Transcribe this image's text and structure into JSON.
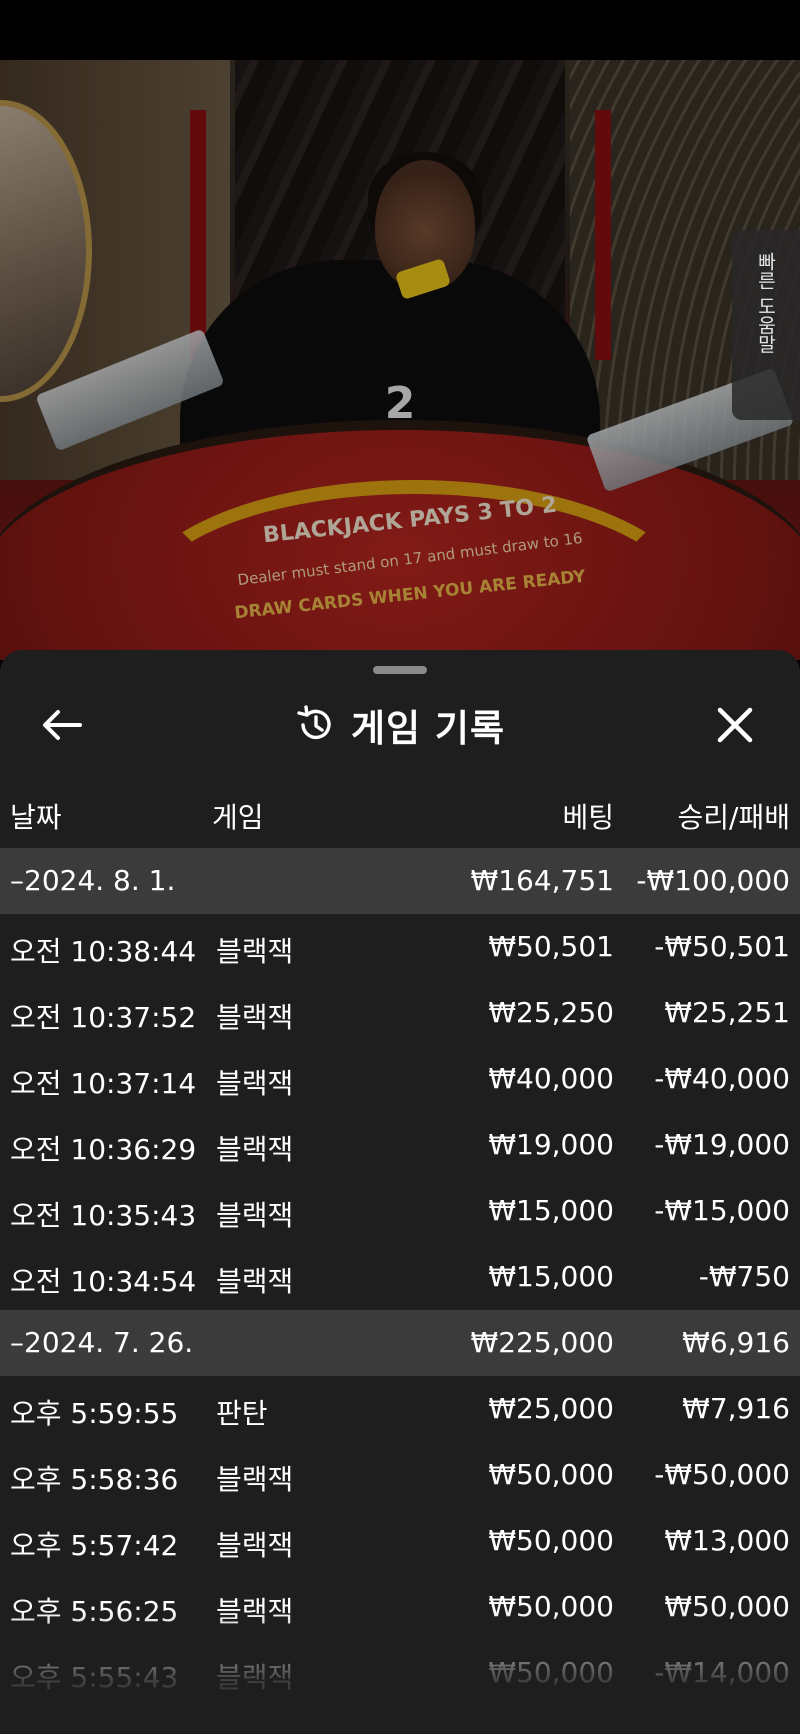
{
  "video": {
    "countdown": "2",
    "table_headline": "BLACKJACK PAYS 3 TO 2",
    "table_rule": "Dealer must stand on 17 and must draw to 16",
    "table_tagline": "DRAW CARDS WHEN YOU ARE READY",
    "help_tab_label": "빠른 도움말"
  },
  "sheet": {
    "title": "게임 기록",
    "columns": {
      "date": "날짜",
      "game": "게임",
      "bet": "베팅",
      "result": "승리/패배"
    },
    "rows": [
      {
        "type": "group",
        "time": "–2024. 8. 1.",
        "game": "",
        "bet": "₩164,751",
        "result": "-₩100,000"
      },
      {
        "type": "item",
        "time": "오전 10:38:44",
        "game": "블랙잭",
        "bet": "₩50,501",
        "result": "-₩50,501"
      },
      {
        "type": "item",
        "time": "오전 10:37:52",
        "game": "블랙잭",
        "bet": "₩25,250",
        "result": "₩25,251"
      },
      {
        "type": "item",
        "time": "오전 10:37:14",
        "game": "블랙잭",
        "bet": "₩40,000",
        "result": "-₩40,000"
      },
      {
        "type": "item",
        "time": "오전 10:36:29",
        "game": "블랙잭",
        "bet": "₩19,000",
        "result": "-₩19,000"
      },
      {
        "type": "item",
        "time": "오전 10:35:43",
        "game": "블랙잭",
        "bet": "₩15,000",
        "result": "-₩15,000"
      },
      {
        "type": "item",
        "time": "오전 10:34:54",
        "game": "블랙잭",
        "bet": "₩15,000",
        "result": "-₩750"
      },
      {
        "type": "group",
        "time": "–2024. 7. 26.",
        "game": "",
        "bet": "₩225,000",
        "result": "₩6,916"
      },
      {
        "type": "item",
        "time": "오후 5:59:55",
        "game": "판탄",
        "bet": "₩25,000",
        "result": "₩7,916"
      },
      {
        "type": "item",
        "time": "오후 5:58:36",
        "game": "블랙잭",
        "bet": "₩50,000",
        "result": "-₩50,000"
      },
      {
        "type": "item",
        "time": "오후 5:57:42",
        "game": "블랙잭",
        "bet": "₩50,000",
        "result": "₩13,000"
      },
      {
        "type": "item",
        "time": "오후 5:56:25",
        "game": "블랙잭",
        "bet": "₩50,000",
        "result": "₩50,000"
      },
      {
        "type": "item",
        "time": "오후 5:55:43",
        "game": "블랙잭",
        "bet": "₩50,000",
        "result": "-₩14,000"
      }
    ]
  }
}
